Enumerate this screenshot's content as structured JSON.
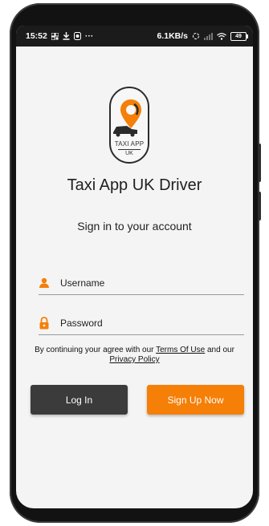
{
  "colors": {
    "accent": "#f57f07",
    "dark_button": "#3b3b3b",
    "screen_bg": "#f4f4f4",
    "status_bar": "#1b1b1b"
  },
  "status_bar": {
    "time": "15:52",
    "network_speed": "6.1KB/s",
    "battery": "49",
    "more": "···"
  },
  "logo": {
    "line1": "TAXI APP",
    "line2": "UK"
  },
  "app_title": "Taxi App UK Driver",
  "subtitle": "Sign in to your account",
  "form": {
    "username": {
      "value": "",
      "placeholder": "Username",
      "icon": "person-icon"
    },
    "password": {
      "value": "",
      "placeholder": "Password",
      "icon": "lock-icon"
    }
  },
  "terms": {
    "prefix": "By continuing your agree with our ",
    "terms_link": "Terms Of Use",
    "middle": " and our ",
    "privacy_link": "Privacy Policy"
  },
  "buttons": {
    "login": "Log In",
    "signup": "Sign Up Now"
  }
}
